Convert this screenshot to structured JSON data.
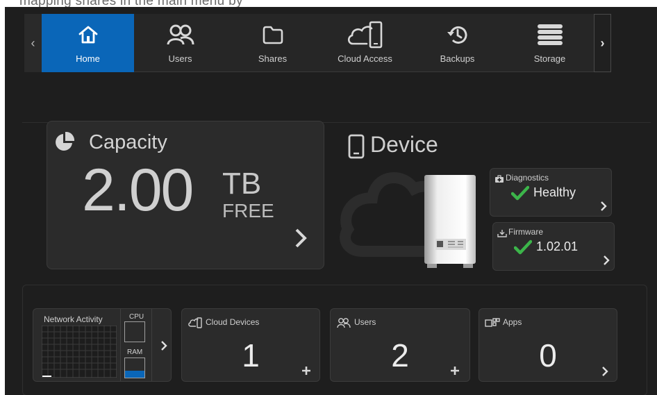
{
  "top_cut_text": "mapping shares in the main menu by",
  "nav": {
    "prev_arrow": "‹",
    "next_arrow": "›",
    "items": [
      {
        "label": "Home",
        "icon": "home-icon",
        "active": true
      },
      {
        "label": "Users",
        "icon": "users-icon",
        "active": false
      },
      {
        "label": "Shares",
        "icon": "folder-icon",
        "active": false
      },
      {
        "label": "Cloud Access",
        "icon": "cloud-device-icon",
        "active": false
      },
      {
        "label": "Backups",
        "icon": "history-icon",
        "active": false
      },
      {
        "label": "Storage",
        "icon": "storage-icon",
        "active": false
      }
    ]
  },
  "capacity": {
    "title": "Capacity",
    "value": "2.00",
    "unit": "TB",
    "suffix": "FREE",
    "icon": "pie-chart-icon"
  },
  "device": {
    "title": "Device",
    "icon": "phone-icon",
    "diagnostics": {
      "label": "Diagnostics",
      "value": "Healthy",
      "icon": "medkit-icon"
    },
    "firmware": {
      "label": "Firmware",
      "value": "1.02.01",
      "icon": "download-icon"
    }
  },
  "bottom": {
    "network": {
      "label": "Network Activity",
      "cpu_label": "CPU",
      "ram_label": "RAM",
      "cpu_level": 0.0,
      "ram_level": 0.35
    },
    "cloud_devices": {
      "label": "Cloud Devices",
      "value": "1",
      "action": "+",
      "icon": "cloud-device-icon"
    },
    "users": {
      "label": "Users",
      "value": "2",
      "action": "+",
      "icon": "users-icon"
    },
    "apps": {
      "label": "Apps",
      "value": "0",
      "action": "›",
      "icon": "apps-icon"
    }
  },
  "colors": {
    "accent": "#0a66b8",
    "success": "#3cb54a",
    "panel": "#2b2b2b",
    "background": "#1e1e1e"
  }
}
